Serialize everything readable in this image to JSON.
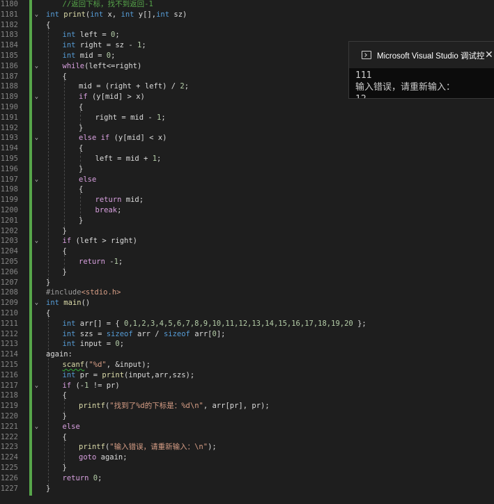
{
  "editor": {
    "lines": [
      {
        "num": "1180",
        "indent": 1,
        "tokens": [
          {
            "t": "//返回下标，找不到返回-1",
            "c": "c"
          }
        ]
      },
      {
        "num": "1181",
        "indent": 0,
        "fold": true,
        "tokens": [
          {
            "t": "int",
            "c": "k"
          },
          {
            "t": " "
          },
          {
            "t": "print",
            "c": "f"
          },
          {
            "t": "("
          },
          {
            "t": "int",
            "c": "k"
          },
          {
            "t": " x, "
          },
          {
            "t": "int",
            "c": "k"
          },
          {
            "t": " y[],"
          },
          {
            "t": "int",
            "c": "k"
          },
          {
            "t": " sz)"
          }
        ]
      },
      {
        "num": "1182",
        "indent": 0,
        "tokens": [
          {
            "t": "{"
          }
        ]
      },
      {
        "num": "1183",
        "indent": 1,
        "tokens": [
          {
            "t": "int",
            "c": "k"
          },
          {
            "t": " left = "
          },
          {
            "t": "0",
            "c": "n"
          },
          {
            "t": ";"
          }
        ]
      },
      {
        "num": "1184",
        "indent": 1,
        "tokens": [
          {
            "t": "int",
            "c": "k"
          },
          {
            "t": " right = sz - "
          },
          {
            "t": "1",
            "c": "n"
          },
          {
            "t": ";"
          }
        ]
      },
      {
        "num": "1185",
        "indent": 1,
        "tokens": [
          {
            "t": "int",
            "c": "k"
          },
          {
            "t": " mid = "
          },
          {
            "t": "0",
            "c": "n"
          },
          {
            "t": ";"
          }
        ]
      },
      {
        "num": "1186",
        "indent": 1,
        "fold": true,
        "tokens": [
          {
            "t": "while",
            "c": "cf"
          },
          {
            "t": "(left<=right)"
          }
        ]
      },
      {
        "num": "1187",
        "indent": 1,
        "tokens": [
          {
            "t": "{"
          }
        ]
      },
      {
        "num": "1188",
        "indent": 2,
        "tokens": [
          {
            "t": "mid = (right + left) / "
          },
          {
            "t": "2",
            "c": "n"
          },
          {
            "t": ";"
          }
        ]
      },
      {
        "num": "1189",
        "indent": 2,
        "fold": true,
        "tokens": [
          {
            "t": "if",
            "c": "cf"
          },
          {
            "t": " (y[mid] > x)"
          }
        ]
      },
      {
        "num": "1190",
        "indent": 2,
        "tokens": [
          {
            "t": "{"
          }
        ]
      },
      {
        "num": "1191",
        "indent": 3,
        "tokens": [
          {
            "t": "right = mid - "
          },
          {
            "t": "1",
            "c": "n"
          },
          {
            "t": ";"
          }
        ]
      },
      {
        "num": "1192",
        "indent": 2,
        "tokens": [
          {
            "t": "}"
          }
        ]
      },
      {
        "num": "1193",
        "indent": 2,
        "fold": true,
        "tokens": [
          {
            "t": "else if",
            "c": "cf"
          },
          {
            "t": " (y[mid] < x)"
          }
        ]
      },
      {
        "num": "1194",
        "indent": 2,
        "tokens": [
          {
            "t": "{"
          }
        ]
      },
      {
        "num": "1195",
        "indent": 3,
        "tokens": [
          {
            "t": "left = mid + "
          },
          {
            "t": "1",
            "c": "n"
          },
          {
            "t": ";"
          }
        ]
      },
      {
        "num": "1196",
        "indent": 2,
        "tokens": [
          {
            "t": "}"
          }
        ]
      },
      {
        "num": "1197",
        "indent": 2,
        "fold": true,
        "tokens": [
          {
            "t": "else",
            "c": "cf"
          }
        ]
      },
      {
        "num": "1198",
        "indent": 2,
        "tokens": [
          {
            "t": "{"
          }
        ]
      },
      {
        "num": "1199",
        "indent": 3,
        "tokens": [
          {
            "t": "return",
            "c": "cf"
          },
          {
            "t": " mid;"
          }
        ]
      },
      {
        "num": "1200",
        "indent": 3,
        "tokens": [
          {
            "t": "break",
            "c": "cf"
          },
          {
            "t": ";"
          }
        ]
      },
      {
        "num": "1201",
        "indent": 2,
        "tokens": [
          {
            "t": "}"
          }
        ]
      },
      {
        "num": "1202",
        "indent": 1,
        "tokens": [
          {
            "t": "}"
          }
        ]
      },
      {
        "num": "1203",
        "indent": 1,
        "fold": true,
        "tokens": [
          {
            "t": "if",
            "c": "cf"
          },
          {
            "t": " (left > right)"
          }
        ]
      },
      {
        "num": "1204",
        "indent": 1,
        "tokens": [
          {
            "t": "{"
          }
        ]
      },
      {
        "num": "1205",
        "indent": 2,
        "tokens": [
          {
            "t": "return",
            "c": "cf"
          },
          {
            "t": " -"
          },
          {
            "t": "1",
            "c": "n"
          },
          {
            "t": ";"
          }
        ]
      },
      {
        "num": "1206",
        "indent": 1,
        "tokens": [
          {
            "t": "}"
          }
        ]
      },
      {
        "num": "1207",
        "indent": 0,
        "tokens": [
          {
            "t": "}"
          }
        ]
      },
      {
        "num": "1208",
        "indent": 0,
        "tokens": [
          {
            "t": "#include",
            "c": "p"
          },
          {
            "t": "<stdio.h>",
            "c": "s"
          }
        ]
      },
      {
        "num": "1209",
        "indent": 0,
        "fold": true,
        "tokens": [
          {
            "t": "int",
            "c": "k"
          },
          {
            "t": " "
          },
          {
            "t": "main",
            "c": "f"
          },
          {
            "t": "()"
          }
        ]
      },
      {
        "num": "1210",
        "indent": 0,
        "tokens": [
          {
            "t": "{"
          }
        ]
      },
      {
        "num": "1211",
        "indent": 1,
        "tokens": [
          {
            "t": "int",
            "c": "k"
          },
          {
            "t": " arr[] = { "
          },
          {
            "t": "0,1,2,3,4,5,6,7,8,9,10,11,12,13,14,15,16,17,18,19,20",
            "c": "n"
          },
          {
            "t": " };"
          }
        ]
      },
      {
        "num": "1212",
        "indent": 1,
        "tokens": [
          {
            "t": "int",
            "c": "k"
          },
          {
            "t": " szs = "
          },
          {
            "t": "sizeof",
            "c": "k"
          },
          {
            "t": " arr / "
          },
          {
            "t": "sizeof",
            "c": "k"
          },
          {
            "t": " arr["
          },
          {
            "t": "0",
            "c": "n"
          },
          {
            "t": "];"
          }
        ]
      },
      {
        "num": "1213",
        "indent": 1,
        "tokens": [
          {
            "t": "int",
            "c": "k"
          },
          {
            "t": " input = "
          },
          {
            "t": "0",
            "c": "n"
          },
          {
            "t": ";"
          }
        ]
      },
      {
        "num": "1214",
        "indent": 0,
        "tokens": [
          {
            "t": "again:"
          }
        ]
      },
      {
        "num": "1215",
        "indent": 1,
        "tokens": [
          {
            "t": "scanf",
            "c": "f sq"
          },
          {
            "t": "("
          },
          {
            "t": "\"%d\"",
            "c": "s"
          },
          {
            "t": ", &input);"
          }
        ]
      },
      {
        "num": "1216",
        "indent": 1,
        "tokens": [
          {
            "t": "int",
            "c": "k"
          },
          {
            "t": " pr = "
          },
          {
            "t": "print",
            "c": "f"
          },
          {
            "t": "(input,arr,szs);"
          }
        ]
      },
      {
        "num": "1217",
        "indent": 1,
        "fold": true,
        "tokens": [
          {
            "t": "if",
            "c": "cf"
          },
          {
            "t": " (-"
          },
          {
            "t": "1",
            "c": "n"
          },
          {
            "t": " != pr)"
          }
        ]
      },
      {
        "num": "1218",
        "indent": 1,
        "tokens": [
          {
            "t": "{"
          }
        ]
      },
      {
        "num": "1219",
        "indent": 2,
        "tokens": [
          {
            "t": "printf",
            "c": "f"
          },
          {
            "t": "("
          },
          {
            "t": "\"找到了%d的下标是：%d\\n\"",
            "c": "s"
          },
          {
            "t": ", arr[pr], pr);"
          }
        ]
      },
      {
        "num": "1220",
        "indent": 1,
        "tokens": [
          {
            "t": "}"
          }
        ]
      },
      {
        "num": "1221",
        "indent": 1,
        "fold": true,
        "tokens": [
          {
            "t": "else",
            "c": "cf"
          }
        ]
      },
      {
        "num": "1222",
        "indent": 1,
        "tokens": [
          {
            "t": "{"
          }
        ]
      },
      {
        "num": "1223",
        "indent": 2,
        "tokens": [
          {
            "t": "printf",
            "c": "f"
          },
          {
            "t": "("
          },
          {
            "t": "\"输入错误，请重新输入：\\n\"",
            "c": "s"
          },
          {
            "t": ");"
          }
        ]
      },
      {
        "num": "1224",
        "indent": 2,
        "tokens": [
          {
            "t": "goto",
            "c": "cf"
          },
          {
            "t": " again;"
          }
        ]
      },
      {
        "num": "1225",
        "indent": 1,
        "tokens": [
          {
            "t": "}"
          }
        ]
      },
      {
        "num": "1226",
        "indent": 1,
        "tokens": [
          {
            "t": "return",
            "c": "cf"
          },
          {
            "t": " "
          },
          {
            "t": "0",
            "c": "n"
          },
          {
            "t": ";"
          }
        ]
      },
      {
        "num": "1227",
        "indent": 0,
        "tokens": [
          {
            "t": "}"
          }
        ]
      }
    ]
  },
  "console": {
    "icon": "console-app-icon",
    "title": "Microsoft Visual Studio 调试控",
    "close_icon": "close-icon",
    "output": [
      "111",
      "输入错误，请重新输入：",
      "12"
    ]
  }
}
